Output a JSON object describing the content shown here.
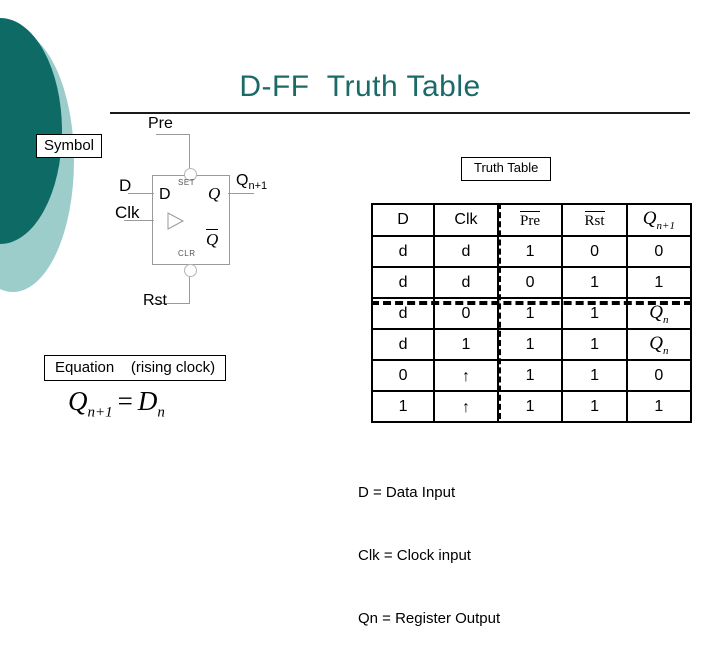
{
  "slide": {
    "title": "D-FF  Truth Table",
    "title_color": "#1a6a68",
    "deco_color_dark": "#0d6a65",
    "deco_color_light": "#9ccdcb"
  },
  "symbol": {
    "box_label": "Symbol",
    "inputs": {
      "d": "D",
      "clk": "Clk",
      "pre": "Pre",
      "rst": "Rst"
    },
    "outputs": {
      "q_next": "Q",
      "q_next_sub": "n+1"
    },
    "pins": {
      "d_in": "D",
      "set": "SET",
      "clr": "CLR",
      "q": "Q",
      "qbar": "Q"
    }
  },
  "equation": {
    "box_label": "Equation    (rising clock)",
    "lhs": "Q",
    "lhs_sub": "n+1",
    "operator": "=",
    "rhs": "D",
    "rhs_sub": "n"
  },
  "truth_table": {
    "box_label": "Truth Table",
    "columns": [
      {
        "label": "D",
        "style": "plain"
      },
      {
        "label": "Clk",
        "style": "plain"
      },
      {
        "label": "Pre",
        "style": "overbar"
      },
      {
        "label": "Rst",
        "style": "overbar"
      },
      {
        "label": "Q",
        "sub": "n+1",
        "style": "italic-sub"
      }
    ],
    "rows": [
      {
        "d": "d",
        "clk": "d",
        "pre": "1",
        "rst": "0",
        "q": "0"
      },
      {
        "d": "d",
        "clk": "d",
        "pre": "0",
        "rst": "1",
        "q": "1"
      },
      {
        "d": "d",
        "clk": "0",
        "pre": "1",
        "rst": "1",
        "q": "Q",
        "q_sub": "n",
        "q_style": "italic-sub"
      },
      {
        "d": "d",
        "clk": "1",
        "pre": "1",
        "rst": "1",
        "q": "Q",
        "q_sub": "n",
        "q_style": "italic-sub"
      },
      {
        "d": "0",
        "clk": "↑",
        "clk_style": "arrow",
        "pre": "1",
        "rst": "1",
        "q": "0"
      },
      {
        "d": "1",
        "clk": "↑",
        "clk_style": "arrow",
        "pre": "1",
        "rst": "1",
        "q": "1"
      }
    ]
  },
  "legend": {
    "line1": "D = Data Input",
    "line2": "Clk = Clock input",
    "line3": "Qn = Register Output"
  }
}
